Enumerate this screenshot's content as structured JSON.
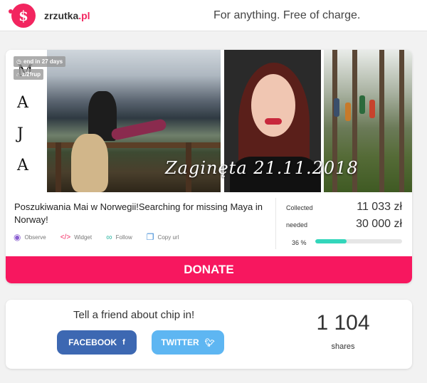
{
  "header": {
    "logo_icon": "zrzutka-logo-icon",
    "logo_name": "zrzutka",
    "logo_tld": ".pl",
    "tagline": "For anything. Free of charge."
  },
  "campaign": {
    "badges": {
      "end": "end in 27 days",
      "id": "z/2frup"
    },
    "photo_letters": [
      "M",
      "A",
      "J",
      "A"
    ],
    "photo_overlay": "Zaginęta 21.11.2018",
    "title": "Poszukiwania Mai w Norwegii!Searching for missing Maya in Norway!",
    "actions": [
      {
        "label": "Observe",
        "icon": "eye-icon"
      },
      {
        "label": "Widget",
        "icon": "code-icon"
      },
      {
        "label": "Follow",
        "icon": "link-icon"
      },
      {
        "label": "Copy url",
        "icon": "copy-icon"
      }
    ],
    "collected_label": "Collected",
    "collected_value": "11 033 zł",
    "needed_label": "needed",
    "needed_value": "30 000 zł",
    "progress_text": "36 %",
    "progress_fraction": 0.36,
    "donate_label": "DONATE"
  },
  "share": {
    "title": "Tell a friend about chip in!",
    "facebook_label": "FACEBOOK",
    "twitter_label": "TWITTER",
    "count": "1 104",
    "count_label": "shares"
  },
  "colors": {
    "brand": "#f7175f",
    "progress": "#33d6bb",
    "facebook": "#3d68b2",
    "twitter": "#5eb6f2"
  }
}
